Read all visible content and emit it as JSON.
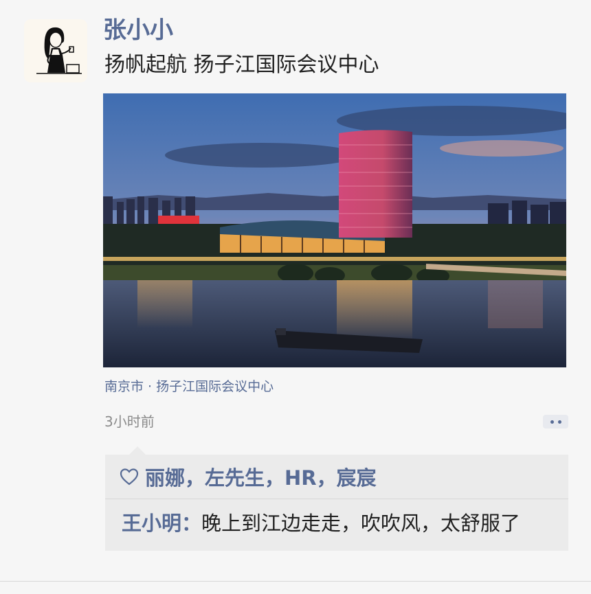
{
  "post": {
    "author": "张小小",
    "text": "扬帆起航 扬子江国际会议中心",
    "location": "南京市 · 扬子江国际会议中心",
    "time": "3小时前"
  },
  "likes": {
    "names": "丽娜，左先生，HR，宸宸"
  },
  "comment": {
    "author": "王小明",
    "separator": "：",
    "text": "晚上到江边走走，吹吹风，太舒服了"
  },
  "colors": {
    "link": "#576b95",
    "background": "#f6f6f6",
    "comment_box": "#ebebeb"
  },
  "icons": [
    "avatar-illustration",
    "heart-icon",
    "more-dots-icon"
  ]
}
